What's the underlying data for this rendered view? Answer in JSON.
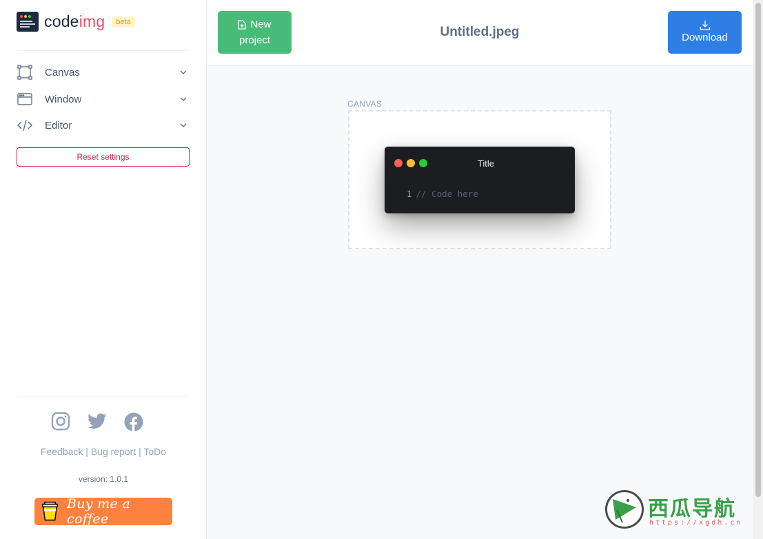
{
  "app": {
    "logo_text_main": "code",
    "logo_text_accent": "img",
    "beta_badge": "beta"
  },
  "sidebar": {
    "items": [
      {
        "label": "Canvas",
        "icon": "canvas-icon"
      },
      {
        "label": "Window",
        "icon": "window-icon"
      },
      {
        "label": "Editor",
        "icon": "code-icon"
      }
    ],
    "reset_label": "Reset settings",
    "socials": [
      "instagram-icon",
      "twitter-icon",
      "facebook-icon"
    ],
    "links": {
      "feedback": "Feedback",
      "bug_report": "Bug report",
      "todo": "ToDo",
      "separator": " | "
    },
    "version": "version: 1.0.1",
    "coffee_label": "Buy me a coffee"
  },
  "header": {
    "new_project_line1": "New",
    "new_project_line2": "project",
    "filename": "Untitled.jpeg",
    "download_label": "Download"
  },
  "canvas": {
    "label": "CANVAS",
    "window_title": "Title",
    "line_number": "1",
    "code_text": "// Code here",
    "dot_colors": [
      "#ff5f57",
      "#febc2e",
      "#28c840"
    ]
  },
  "watermark": {
    "text": "西瓜导航",
    "url": "https://xgdh.cn"
  },
  "colors": {
    "new_project_bg": "#48bb78",
    "download_bg": "#2f7ee6",
    "reset_border": "#e11d48",
    "logo_accent": "#ef4b6c",
    "coffee_bg": "#ff813f"
  }
}
